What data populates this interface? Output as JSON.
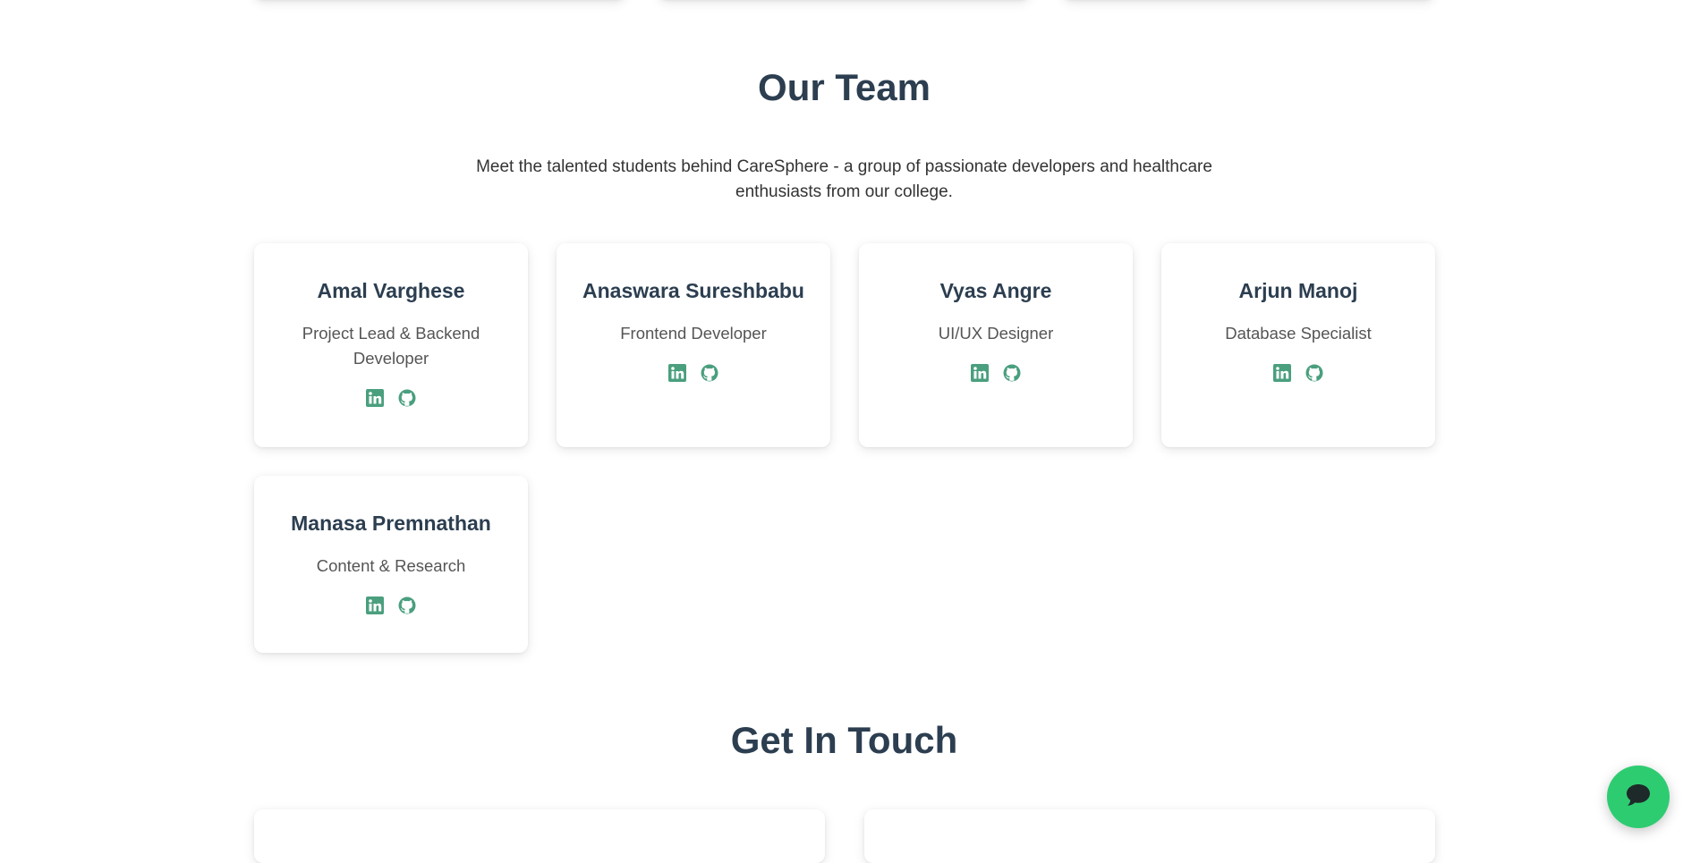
{
  "team": {
    "title": "Our Team",
    "intro": "Meet the talented students behind CareSphere - a group of passionate developers and healthcare enthusiasts from our college.",
    "members": [
      {
        "name": "Amal Varghese",
        "role": "Project Lead & Backend Developer"
      },
      {
        "name": "Anaswara Sureshbabu",
        "role": "Frontend Developer"
      },
      {
        "name": "Vyas Angre",
        "role": "UI/UX Designer"
      },
      {
        "name": "Arjun Manoj",
        "role": "Database Specialist"
      },
      {
        "name": "Manasa Premnathan",
        "role": "Content & Research"
      }
    ],
    "social_icons": [
      "linkedin-icon",
      "github-icon"
    ]
  },
  "contact": {
    "title": "Get In Touch"
  },
  "chat": {
    "icon": "chat-bubble-icon"
  },
  "colors": {
    "accent": "#4a9f7e",
    "heading": "#2c3e50",
    "chat_button": "#2ecc71"
  }
}
